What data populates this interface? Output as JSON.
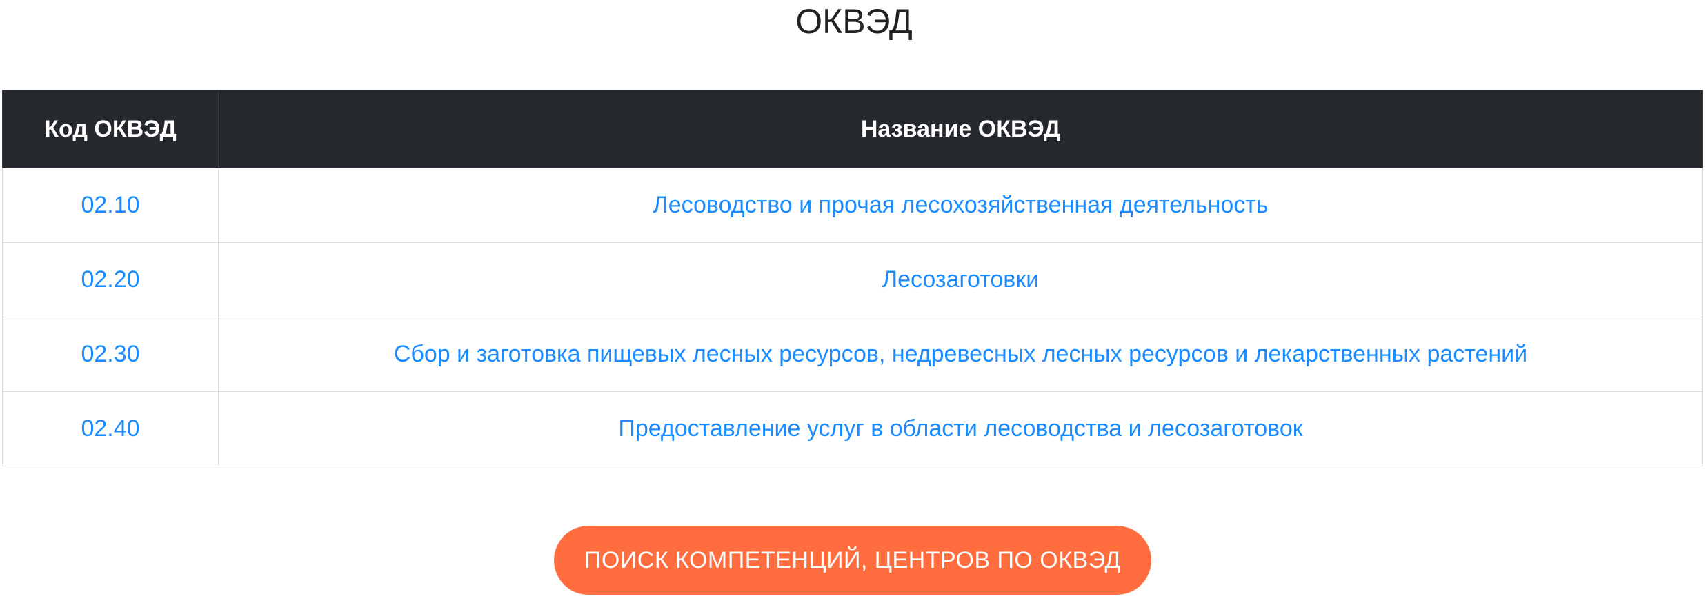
{
  "title": "ОКВЭД",
  "table": {
    "headers": {
      "code": "Код ОКВЭД",
      "name": "Название ОКВЭД"
    },
    "rows": [
      {
        "code": "02.10",
        "name": "Лесоводство и прочая лесохозяйственная деятельность"
      },
      {
        "code": "02.20",
        "name": "Лесозаготовки"
      },
      {
        "code": "02.30",
        "name": "Сбор и заготовка пищевых лесных ресурсов, недревесных лесных ресурсов и лекарственных растений"
      },
      {
        "code": "02.40",
        "name": "Предоставление услуг в области лесоводства и лесозаготовок"
      }
    ]
  },
  "search_button": {
    "label": "ПОИСК КОМПЕТЕНЦИЙ, ЦЕНТРОВ ПО ОКВЭД"
  },
  "colors": {
    "header_bg": "#25282c",
    "link": "#1a8cff",
    "button_bg": "#ff6d3f"
  }
}
